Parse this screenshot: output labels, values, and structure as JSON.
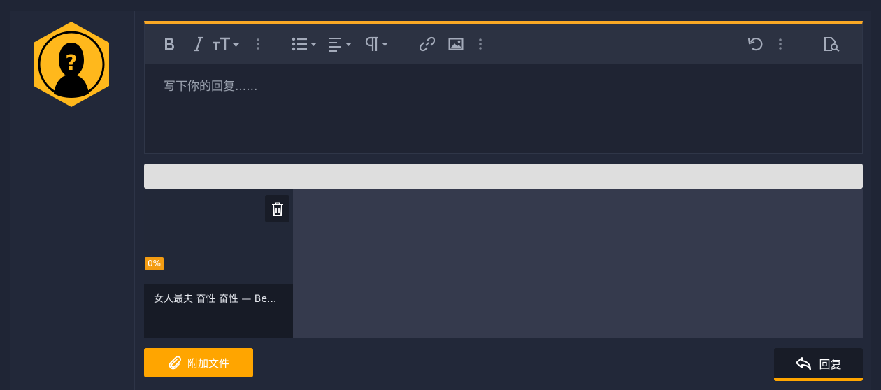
{
  "editor": {
    "placeholder": "写下你的回复......",
    "toolbar": [
      {
        "name": "bold-button",
        "icon": "bold-icon"
      },
      {
        "name": "italic-button",
        "icon": "italic-icon"
      },
      {
        "name": "text-size-button",
        "icon": "text-size-icon"
      },
      {
        "name": "more-text-button",
        "icon": "more-vertical-icon"
      },
      {
        "name": "list-button",
        "icon": "list-icon"
      },
      {
        "name": "align-button",
        "icon": "align-left-icon"
      },
      {
        "name": "paragraph-button",
        "icon": "paragraph-icon"
      },
      {
        "name": "link-button",
        "icon": "link-icon"
      },
      {
        "name": "image-button",
        "icon": "image-icon"
      },
      {
        "name": "more-insert-button",
        "icon": "more-vertical-icon"
      },
      {
        "name": "undo-button",
        "icon": "undo-icon"
      },
      {
        "name": "more-options-button",
        "icon": "more-vertical-icon"
      },
      {
        "name": "preview-button",
        "icon": "preview-icon"
      }
    ]
  },
  "upload": {
    "file_name": "女人最夫 奋性 奋性 — Be...",
    "progress": "0%",
    "progress_value": 0
  },
  "actions": {
    "attach_label": "附加文件",
    "reply_label": "回复"
  },
  "colors": {
    "accent": "#ffa500",
    "background": "#1f2535",
    "toolbar": "#2c3242"
  }
}
